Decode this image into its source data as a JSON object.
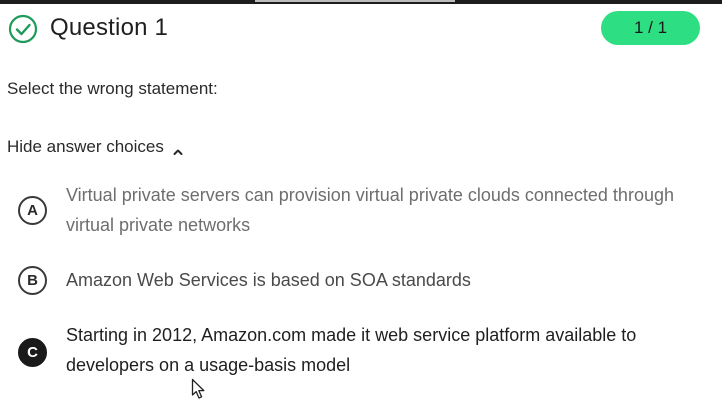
{
  "question": {
    "title": "Question 1",
    "score": "1 / 1",
    "prompt": "Select the wrong statement:",
    "toggle_label": "Hide answer choices",
    "status_icon": "check-circle-icon",
    "accent_color": "#2dde83"
  },
  "choices": [
    {
      "letter": "A",
      "text": "Virtual private servers can provision virtual private clouds connected through virtual private networks",
      "selected": false
    },
    {
      "letter": "B",
      "text": "Amazon Web Services is based on SOA standards",
      "selected": false
    },
    {
      "letter": "C",
      "text": "Starting in 2012, Amazon.com made it web service platform available to developers on a usage-basis model",
      "selected": true
    }
  ]
}
